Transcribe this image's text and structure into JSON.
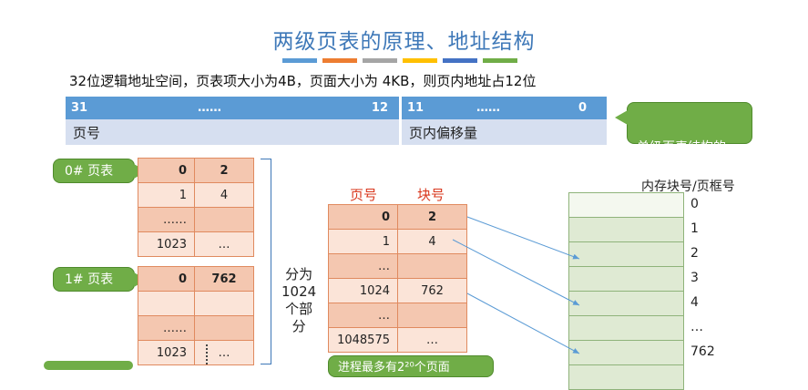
{
  "title": "两级页表的原理、地址结构",
  "stripe_colors": [
    "#5b9bd5",
    "#ed7d31",
    "#a5a5a5",
    "#ffc000",
    "#4472c4",
    "#70ad47"
  ],
  "description": "32位逻辑地址空间，页表项大小为4B，页面大小为 4KB，则页内地址占12位",
  "address": {
    "left_head": {
      "high": "31",
      "dots": "……",
      "low": "12"
    },
    "right_head": {
      "high": "11",
      "dots": "……",
      "low": "0"
    },
    "left_label": "页号",
    "right_label": "页内偏移量"
  },
  "callout_struct": "单级页表结构的\n逻辑地址结构",
  "pt0": {
    "label": "0# 页表",
    "rows": [
      [
        "0",
        "2"
      ],
      [
        "1",
        "4"
      ],
      [
        "……",
        ""
      ],
      [
        "1023",
        "…"
      ]
    ]
  },
  "pt1": {
    "label": "1# 页表",
    "rows": [
      [
        "0",
        "762"
      ],
      [
        "",
        ""
      ],
      [
        "……",
        ""
      ],
      [
        "1023",
        "…"
      ]
    ]
  },
  "split_text": "分为\n1024\n个部\n分",
  "big_table": {
    "col_page": "页号",
    "col_block": "块号",
    "rows": [
      [
        "0",
        "2"
      ],
      [
        "1",
        "4"
      ],
      [
        "…",
        ""
      ],
      [
        "1024",
        "762"
      ],
      [
        "…",
        ""
      ],
      [
        "1048575",
        "…"
      ]
    ]
  },
  "bottom_callout": "进程最多有2²⁰个页面",
  "memory": {
    "title": "内存块号/页框号",
    "numbers": [
      "0",
      "1",
      "2",
      "3",
      "4",
      "…",
      "762"
    ]
  },
  "colors": {
    "title": "#3e78b8",
    "header_blue": "#5b9bd5",
    "row_blue": "#d6dff0",
    "callout_green": "#70ad47",
    "cell_orange": "#f4c7b0",
    "red_label": "#d9381e",
    "memory_green": "#dfead3"
  }
}
